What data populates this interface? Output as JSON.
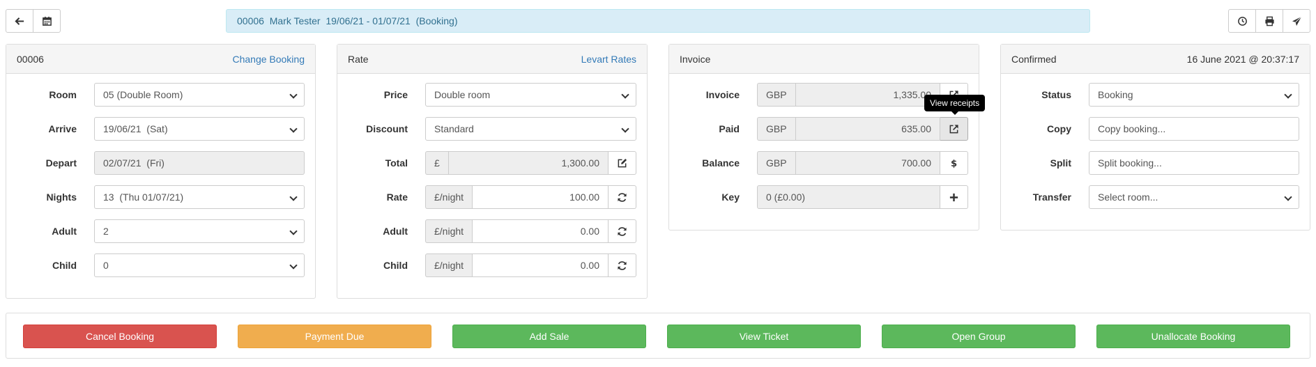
{
  "header": {
    "title": "00006  Mark Tester  19/06/21 - 01/07/21  (Booking)",
    "left_icons": [
      "arrow-left-icon",
      "calendar-icon"
    ],
    "right_icons": [
      "clock-icon",
      "print-icon",
      "send-icon"
    ]
  },
  "booking_panel": {
    "title": "00006",
    "link": "Change Booking",
    "room_label": "Room",
    "room_value": "05 (Double Room)",
    "arrive_label": "Arrive",
    "arrive_value": "19/06/21  (Sat)",
    "depart_label": "Depart",
    "depart_value": "02/07/21  (Fri)",
    "nights_label": "Nights",
    "nights_value": "13  (Thu 01/07/21)",
    "adult_label": "Adult",
    "adult_value": "2",
    "child_label": "Child",
    "child_value": "0"
  },
  "rate_panel": {
    "title": "Rate",
    "link": "Levart Rates",
    "price_label": "Price",
    "price_value": "Double room",
    "discount_label": "Discount",
    "discount_value": "Standard",
    "total_label": "Total",
    "total_prefix": "£",
    "total_value": "1,300.00",
    "rate_label": "Rate",
    "rate_prefix": "£/night",
    "rate_value": "100.00",
    "adult_label": "Adult",
    "adult_prefix": "£/night",
    "adult_value": "0.00",
    "child_label": "Child",
    "child_prefix": "£/night",
    "child_value": "0.00"
  },
  "invoice_panel": {
    "title": "Invoice",
    "invoice_label": "Invoice",
    "invoice_currency": "GBP",
    "invoice_value": "1,335.00",
    "paid_label": "Paid",
    "paid_currency": "GBP",
    "paid_value": "635.00",
    "balance_label": "Balance",
    "balance_currency": "GBP",
    "balance_value": "700.00",
    "key_label": "Key",
    "key_value": "0 (£0.00)",
    "tooltip": "View receipts"
  },
  "status_panel": {
    "title": "Confirmed",
    "timestamp": "16 June 2021 @ 20:37:17",
    "status_label": "Status",
    "status_value": "Booking",
    "copy_label": "Copy",
    "copy_value": "Copy booking...",
    "split_label": "Split",
    "split_value": "Split booking...",
    "transfer_label": "Transfer",
    "transfer_value": "Select room..."
  },
  "actions": {
    "cancel": "Cancel Booking",
    "payment_due": "Payment Due",
    "add_sale": "Add Sale",
    "view_ticket": "View Ticket",
    "open_group": "Open Group",
    "unallocate": "Unallocate Booking"
  },
  "colors": {
    "danger": "#d9534f",
    "warning": "#f0ad4e",
    "success": "#5cb85c",
    "link": "#337ab7",
    "title_bg": "#d9edf7"
  }
}
